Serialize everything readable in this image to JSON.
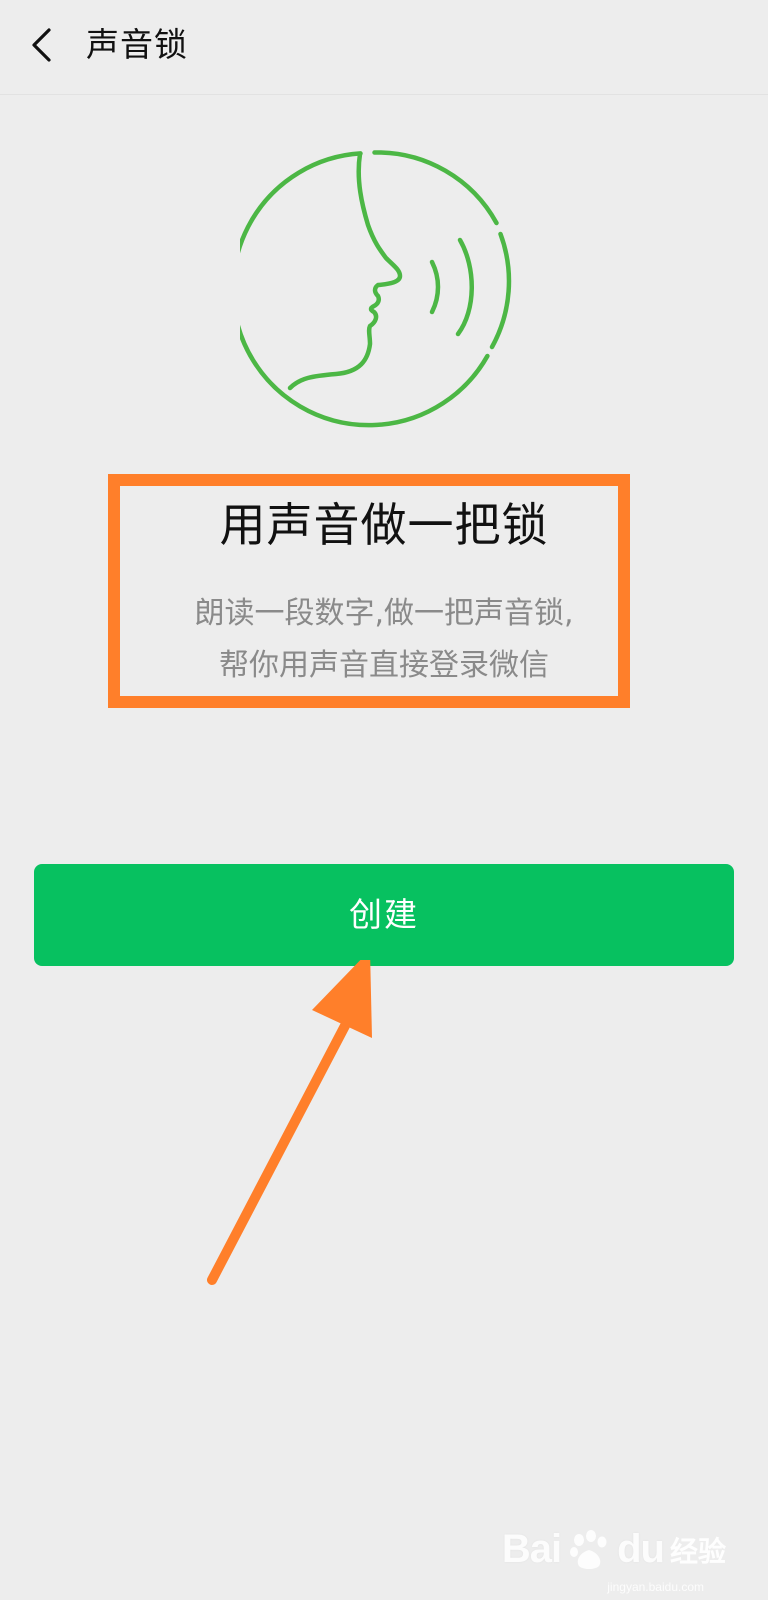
{
  "header": {
    "title": "声音锁",
    "back_icon": "chevron-left-icon"
  },
  "hero": {
    "icon": "speaking-face-icon",
    "accent_color": "#4cb745"
  },
  "intro": {
    "headline": "用声音做一把锁",
    "description_line1": "朗读一段数字,做一把声音锁,",
    "description_line2": "帮你用声音直接登录微信"
  },
  "actions": {
    "create_label": "创建",
    "button_color": "#07c160"
  },
  "annotations": {
    "highlight_color": "#ff7f2a",
    "arrow_color": "#ff7f2a"
  },
  "watermark": {
    "brand": "Bai",
    "brand_suffix": "du",
    "brand_cn": "经验",
    "url": "jingyan.baidu.com"
  }
}
